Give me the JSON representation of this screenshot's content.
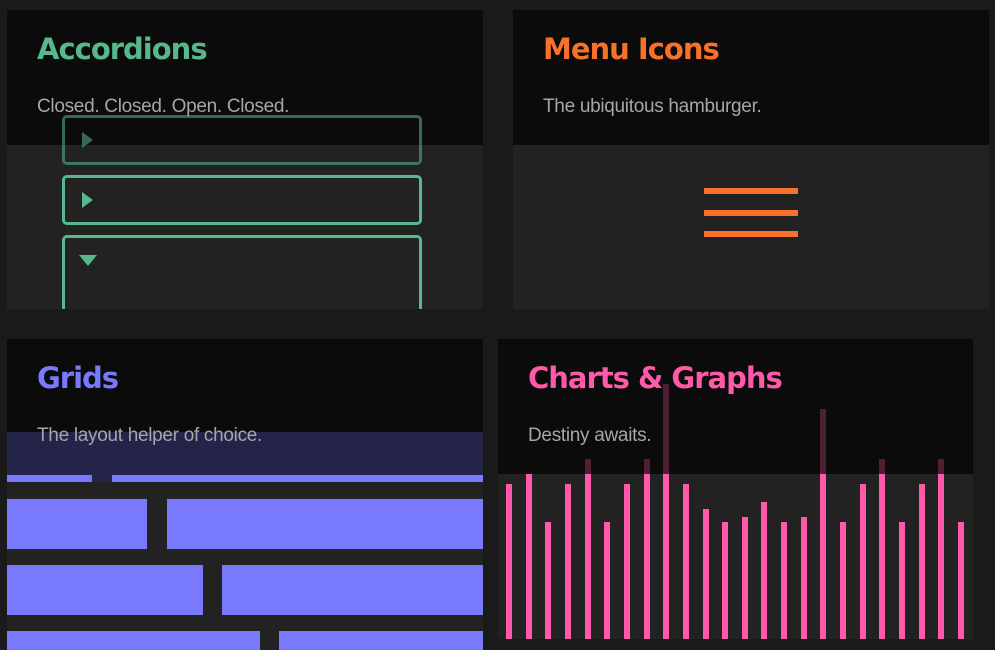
{
  "colors": {
    "background": "#1a1a1a",
    "card_body": "#222222",
    "card_header": "#0b0b0b",
    "description": "#a6a6a6",
    "accordions": "#57b98b",
    "menu_icons": "#f7712b",
    "grids": "#7979fd",
    "charts": "#ff5aaa"
  },
  "cards": {
    "accordions": {
      "title": "Accordions",
      "description": "Closed. Closed. Open. Closed.",
      "items": [
        {
          "state": "closed",
          "icon": "triangle-right-icon"
        },
        {
          "state": "closed",
          "icon": "triangle-right-icon"
        },
        {
          "state": "open",
          "icon": "triangle-down-icon"
        }
      ]
    },
    "menu_icons": {
      "title": "Menu Icons",
      "description": "The ubiquitous hamburger.",
      "icon": "hamburger-menu-icon"
    },
    "grids": {
      "title": "Grids",
      "description": "The layout helper of choice."
    },
    "charts": {
      "title": "Charts & Graphs",
      "description": "Destiny awaits.",
      "chart_data": {
        "type": "bar",
        "title": "",
        "bar_values": [
          155,
          165,
          117,
          155,
          165,
          117,
          155,
          165,
          165,
          155,
          130,
          117,
          122,
          137,
          117,
          122,
          165,
          117,
          155,
          165,
          117,
          155,
          165,
          117
        ],
        "ghost_values": [
          null,
          null,
          null,
          null,
          180,
          null,
          null,
          180,
          255,
          null,
          null,
          null,
          null,
          null,
          null,
          null,
          230,
          null,
          null,
          180,
          null,
          null,
          180,
          null
        ]
      }
    }
  }
}
